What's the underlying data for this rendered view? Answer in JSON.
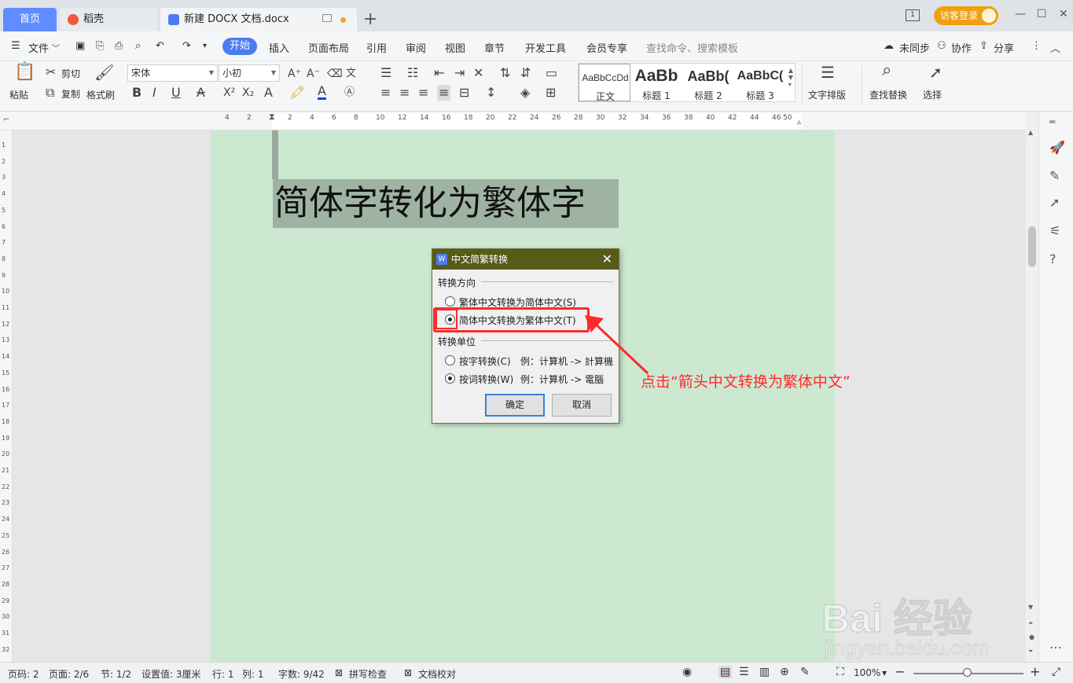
{
  "tabs": {
    "home": "首页",
    "daoke": "稻壳",
    "doc": "新建 DOCX 文档.docx",
    "login": "访客登录",
    "win_box": "1"
  },
  "menu": {
    "file": "文件",
    "start": "开始",
    "insert": "插入",
    "layout": "页面布局",
    "references": "引用",
    "review": "审阅",
    "view": "视图",
    "chapter": "章节",
    "devtools": "开发工具",
    "member": "会员专享",
    "search_placeholder": "查找命令、搜索模板",
    "unsync": "未同步",
    "collab": "协作",
    "share": "分享"
  },
  "ribbon": {
    "paste": "粘贴",
    "cut": "剪切",
    "copy": "复制",
    "format_painter": "格式刷",
    "font_name": "宋体",
    "font_size": "小初",
    "styles": [
      {
        "sample": "AaBbCcDd",
        "name": "正文"
      },
      {
        "sample": "AaBb",
        "name": "标题 1"
      },
      {
        "sample": "AaBb(",
        "name": "标题 2"
      },
      {
        "sample": "AaBbC(",
        "name": "标题 3"
      }
    ],
    "text_layout": "文字排版",
    "find_replace": "查找替换",
    "select": "选择"
  },
  "ruler": {
    "h_ticks": [
      "4",
      "2",
      "2",
      "4",
      "6",
      "8",
      "10",
      "12",
      "14",
      "16",
      "18",
      "20",
      "22",
      "24",
      "26",
      "28",
      "30",
      "32",
      "34",
      "36",
      "38",
      "40",
      "42",
      "44",
      "46",
      "50"
    ],
    "v_ticks": [
      "1",
      "2",
      "3",
      "4",
      "5",
      "6",
      "7",
      "8",
      "9",
      "10",
      "11",
      "12",
      "13",
      "14",
      "15",
      "16",
      "17",
      "18",
      "19",
      "20",
      "21",
      "22",
      "23",
      "24",
      "25",
      "26",
      "27",
      "28",
      "29",
      "30",
      "31",
      "32"
    ]
  },
  "document": {
    "title_text": "简体字转化为繁体字"
  },
  "dialog": {
    "title": "中文简繁转换",
    "direction_label": "转换方向",
    "opt_trad_to_simp": "繁体中文转换为简体中文(S)",
    "opt_simp_to_trad": "简体中文转换为繁体中文(T)",
    "unit_label": "转换单位",
    "opt_by_char": "按字转换(C)",
    "opt_by_char_example": "例：计算机 -> 計算機",
    "opt_by_word": "按词转换(W)",
    "opt_by_word_example": "例：计算机 -> 電腦",
    "ok": "确定",
    "cancel": "取消"
  },
  "annotation": {
    "text": "点击“箭头中文转换为繁体中文”",
    "color": "#ff2a2a"
  },
  "watermark": {
    "brand": "Bai 经验",
    "url": "jingyan.baidu.com"
  },
  "status": {
    "page_code": "页码: 2",
    "page": "页面: 2/6",
    "section": "节: 1/2",
    "setting": "设置值: 3厘米",
    "row": "行: 1",
    "col": "列: 1",
    "word_count": "字数: 9/42",
    "spell_check": "拼写检查",
    "doc_proof": "文档校对",
    "zoom": "100%"
  },
  "colors": {
    "accent": "#4c7cf3",
    "page_bg": "#cde8d1",
    "dialog_title": "#585a1a"
  }
}
